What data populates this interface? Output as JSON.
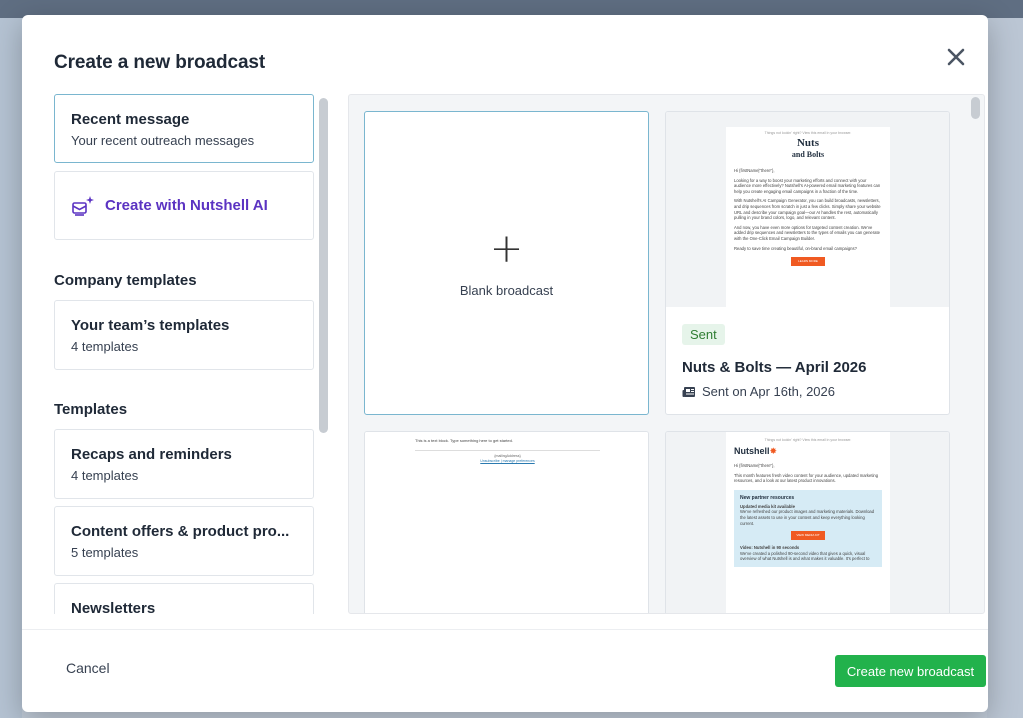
{
  "modal": {
    "title": "Create a new broadcast",
    "close_icon": "close-icon"
  },
  "sidebar": {
    "recent": {
      "title": "Recent message",
      "subtitle": "Your recent outreach messages"
    },
    "ai": {
      "label": "Create with Nutshell AI",
      "icon": "ai-sparkle-icon"
    },
    "company_heading": "Company templates",
    "team": {
      "title": "Your team’s templates",
      "subtitle": "4 templates"
    },
    "templates_heading": "Templates",
    "items": [
      {
        "title": "Recaps and reminders",
        "subtitle": "4 templates"
      },
      {
        "title": "Content offers & product pro...",
        "subtitle": "5 templates"
      },
      {
        "title": "Newsletters",
        "subtitle": ""
      }
    ]
  },
  "grid": {
    "blank": {
      "label": "Blank broadcast",
      "plus": "+"
    },
    "nuts_bolts": {
      "badge": "Sent",
      "title": "Nuts & Bolts — April 2026",
      "meta": "Sent on Apr 16th, 2026",
      "preview": {
        "top": "Things not lookin' right? View this email in your browser.",
        "logo_line1": "Nuts",
        "logo_line2": "and Bolts",
        "greeting": "Hi {firstName|\"there\"},",
        "p1": "Looking for a way to boost your marketing efforts and connect with your audience more effectively? Nutshell's AI-powered email marketing features can help you create engaging email campaigns in a fraction of the time.",
        "p2": "With Nutshell's AI Campaign Generator, you can build broadcasts, newsletters, and drip sequences from scratch in just a few clicks. Simply share your website URL and describe your campaign goal—our AI handles the rest, automatically pulling in your brand colors, logo, and relevant content.",
        "p3": "And now, you have even more options for targeted content creation. We've added drip sequences and newsletters to the types of emails you can generate with the One-Click Email Campaign Builder.",
        "p4": "Ready to save time creating beautiful, on-brand email campaigns?",
        "button": "LEARN MORE"
      }
    },
    "text_block": {
      "line1": "This is a text block. Type something here to get started.",
      "line2": "{mailingAddress}",
      "line3": "Unsubscribe | manage preferences"
    },
    "nutshell": {
      "top": "Things not lookin' right? View this email in your browser.",
      "logo": "Nutshell",
      "greeting": "Hi {firstName|\"there\"},",
      "intro": "This month features fresh video content for your audience, updated marketing resources, and a look at our latest product innovations.",
      "block_title": "New partner resources",
      "sub1": "Updated media kit available",
      "sub1_text": "We've refreshed our product images and marketing materials. Download the latest assets to use in your content and keep everything looking current.",
      "button": "VIEW MEDIA KIT",
      "sub2": "Video: Nutshell in 90 seconds",
      "sub2_text": "We've created a polished 90-second video that gives a quick, visual overview of what Nutshell is and what makes it valuable. It's perfect to"
    }
  },
  "footer": {
    "cancel": "Cancel",
    "create": "Create new broadcast"
  },
  "colors": {
    "primary_green": "#22b24c",
    "ai_purple": "#5b33c2",
    "selected_border": "#7ab6cf",
    "brand_orange": "#f05a22"
  }
}
